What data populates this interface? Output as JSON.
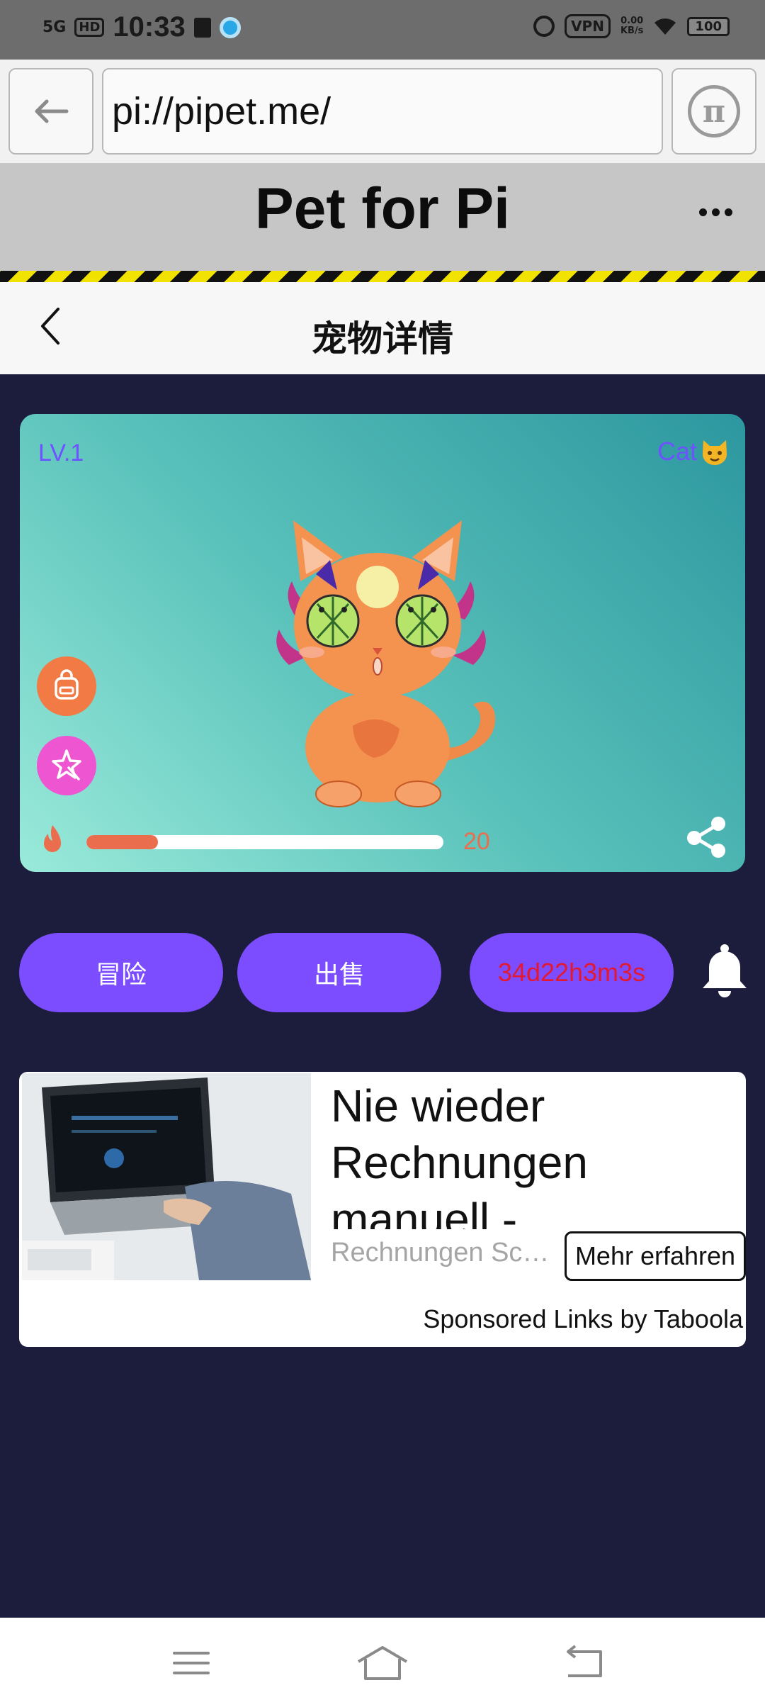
{
  "status_bar": {
    "network": "5G",
    "hd": "HD",
    "time": "10:33",
    "vpn": "VPN",
    "speed_value": "0.00",
    "speed_unit": "KB/s",
    "battery": "100"
  },
  "browser": {
    "url": "pi://pipet.me/"
  },
  "app_header": {
    "title": "Pet for Pi"
  },
  "detail": {
    "title": "宠物详情"
  },
  "pet": {
    "level": "LV.1",
    "type": "Cat",
    "energy_value": "20",
    "energy_fraction": 0.2,
    "colors": {
      "card_start": "#9aeada",
      "card_end": "#2c979f",
      "label": "#6f52ff",
      "energy": "#ea6e4e"
    }
  },
  "actions": {
    "adventure": "冒险",
    "sell": "出售",
    "timer": "34d22h3m3s",
    "accent": "#7b4dff",
    "timer_color": "#e31931"
  },
  "ad": {
    "headline": "Nie wieder Rechnungen manuell -…",
    "source": "Rechnungen Sc…",
    "cta": "Mehr erfahren",
    "sponsor": "Sponsored Links by Taboola"
  },
  "icons": {
    "back": "arrow-left-icon",
    "pi": "pi-logo-icon",
    "more": "more-dots-icon",
    "chevron": "chevron-left-icon",
    "bag": "backpack-icon",
    "magic": "magic-star-icon",
    "flame": "flame-icon",
    "share": "share-icon",
    "bell": "bell-icon",
    "nav_menu": "menu-icon",
    "nav_home": "home-icon",
    "nav_back": "back-icon"
  }
}
